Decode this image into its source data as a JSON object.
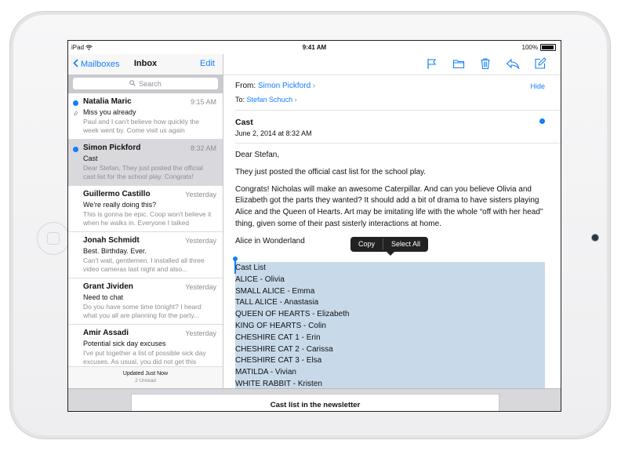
{
  "status_bar": {
    "device": "iPad",
    "time": "9:41 AM",
    "battery": "100%"
  },
  "sidebar": {
    "back_label": "Mailboxes",
    "title": "Inbox",
    "edit_label": "Edit",
    "search_placeholder": "Search",
    "messages": [
      {
        "sender": "Natalia Maric",
        "time": "9:15 AM",
        "subject": "Miss you already",
        "preview": "Paul and I can't believe how quickly the week went by. Come visit us again",
        "unread": true,
        "attachment": true
      },
      {
        "sender": "Simon Pickford",
        "time": "8:32 AM",
        "subject": "Cast",
        "preview": "Dear Stefan, They just posted the official cast list for the school play. Congrats!",
        "unread": true,
        "selected": true
      },
      {
        "sender": "Guillermo Castillo",
        "time": "Yesterday",
        "subject": "We're really doing this?",
        "preview": "This is gonna be epic. Coop won't believe it when he walks in. Everyone I talked"
      },
      {
        "sender": "Jonah Schmidt",
        "time": "Yesterday",
        "subject": "Best. Birthday. Ever.",
        "preview": "Can't wait, gentlemen. I installed all three video cameras last night and also..."
      },
      {
        "sender": "Grant Jividen",
        "time": "Yesterday",
        "subject": "Need to chat",
        "preview": "Do you have some time tonight? I heard what you all are planning for the party..."
      },
      {
        "sender": "Amir Assadi",
        "time": "Yesterday",
        "subject": "Potential sick day excuses",
        "preview": "I've put together a list of possible sick day excuses. As usual, you did not get this"
      }
    ],
    "updated": "Updated Just Now",
    "unread_count": "2 Unread"
  },
  "message": {
    "from_label": "From:",
    "from": "Simon Pickford",
    "to_label": "To:",
    "to": "Stefan Schuch",
    "hide_label": "Hide",
    "subject": "Cast",
    "date": "June 2, 2014 at 8:32 AM",
    "greeting": "Dear Stefan,",
    "p1": "They just posted the official cast list for the school play.",
    "p2": "Congrats! Nicholas will make an awesome Caterpillar. And can you believe Olivia and Elizabeth got the parts they wanted? It should add a bit of drama to have sisters playing Alice and the Queen of Hearts. Art may be imitating life with the whole “off with her head” thing, given some of their past sisterly interactions at home.",
    "play_title": "Alice in Wonderland",
    "cast_list": [
      "Cast List",
      "ALICE - Olivia",
      "SMALL ALICE - Emma",
      "TALL ALICE - Anastasia",
      "QUEEN OF HEARTS - Elizabeth",
      "KING OF HEARTS - Colin",
      "CHESHIRE CAT 1 - Erin",
      "CHESHIRE CAT 2 - Carissa",
      "CHESHIRE CAT 3 - Elsa",
      "MATILDA - Vivian",
      "WHITE RABBIT - Kristen"
    ]
  },
  "popup": {
    "copy": "Copy",
    "select_all": "Select All"
  },
  "draft": {
    "title": "Cast list in the newsletter"
  }
}
